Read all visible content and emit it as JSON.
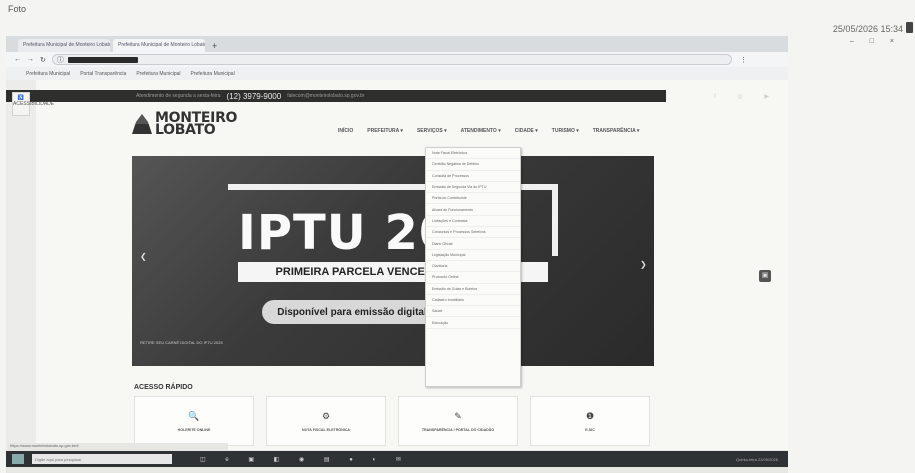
{
  "photo": {
    "label": "Foto",
    "timestamp": "25/05/2026 15:34"
  },
  "browser": {
    "tabs": [
      "Prefeitura Municipal de Monteiro Lobato",
      "Prefeitura Municipal de Monteiro Lobato"
    ],
    "new_tab": "+",
    "window_controls": "– □ ×",
    "bookmarks": [
      "Prefeitura Municipal",
      "Portal Transparência",
      "Prefeitura Municipal",
      "Prefeitura Municipal"
    ]
  },
  "site": {
    "access_button": "ACESSIBILIDADE",
    "topbar": {
      "contact": "Atendimento de segunda a sexta-feira",
      "phone": "(12) 3979-9000",
      "email": "falecom@monteirolobato.sp.gov.br"
    },
    "logo_line1": "MONTEIRO",
    "logo_line2": "LOBATO",
    "nav": [
      "INÍCIO",
      "PREFEITURA ▾",
      "SERVIÇOS ▾",
      "ATENDIMENTO ▾",
      "CIDADE ▾",
      "TURISMO ▾",
      "TRANSPARÊNCIA ▾"
    ],
    "hero": {
      "title": "IPTU 2025",
      "banner": "PRIMEIRA PARCELA VENCE ESTA SEMANA!",
      "pill": "Disponível para emissão digital",
      "small": "RETIRE SEU CARNÊ DIGITAL DO IPTU 2025"
    },
    "dropdown": [
      "Nota Fiscal Eletrônica",
      "Certidão Negativa de Débitos",
      "Consulta de Processos",
      "Emissão de Segunda Via do IPTU",
      "Portal do Contribuinte",
      "Alvará de Funcionamento",
      "Licitações e Contratos",
      "Concursos e Processos Seletivos",
      "Diário Oficial",
      "Legislação Municipal",
      "Ouvidoria",
      "Protocolo Online",
      "Emissão de Guias e Boletos",
      "Cadastro Imobiliário",
      "Saúde",
      "Educação"
    ],
    "access_title": "ACESSO RÁPIDO",
    "cards": [
      {
        "icon": "🔍",
        "label": "HOLERITE ONLINE"
      },
      {
        "icon": "⚙",
        "label": "NOTA FISCAL ELETRÔNICA"
      },
      {
        "icon": "✎",
        "label": "TRANSPARÊNCIA / PORTAL DO CIDADÃO"
      },
      {
        "icon": "❶",
        "label": "E-SIC"
      }
    ],
    "status_url": "https://www.monteirolobato.sp.gov.br/#"
  },
  "taskbar": {
    "search_placeholder": "Digite aqui para pesquisar",
    "icons": "◫ e ▣ ◧ ◉ ▤ ● ◐ ✉",
    "tray": "Quinta-feira 22/05/2026"
  }
}
